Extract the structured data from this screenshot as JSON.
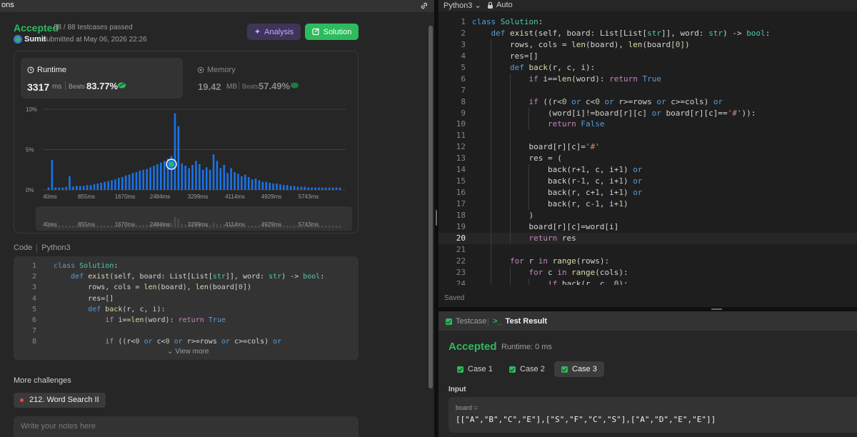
{
  "left_panel": {
    "tab_label": "ons",
    "status": "Accepted",
    "testcases": "88 / 88 testcases passed",
    "username": "Sumit",
    "submitted_text": "submitted at May 06, 2026 22:26",
    "analysis_label": "Analysis",
    "solution_label": "Solution",
    "runtime": {
      "title": "Runtime",
      "value": "3317",
      "unit": "ms",
      "beats_label": "Beats",
      "beats_value": "83.77%"
    },
    "memory": {
      "title": "Memory",
      "value": "19.42",
      "unit": "MB",
      "beats_label": "Beats",
      "beats_value": "57.49%"
    },
    "code_label": "Code",
    "code_lang": "Python3",
    "code_preview": [
      {
        "n": "1",
        "html": "<span class='kw'>class</span> <span class='ty'>Solution</span>:"
      },
      {
        "n": "2",
        "html": "    <span class='kw'>def</span> <span class='fn'>exist</span>(self, board: List[List[<span class='ty'>str</span>]], word: <span class='ty'>str</span>) -> <span class='ty'>bool</span>:"
      },
      {
        "n": "3",
        "html": "        rows, cols = <span class='fn'>len</span>(board), <span class='fn'>len</span>(board[<span class='num'>0</span>])"
      },
      {
        "n": "4",
        "html": "        res=[]"
      },
      {
        "n": "5",
        "html": "        <span class='kw'>def</span> <span class='fn'>back</span>(r, c, i):"
      },
      {
        "n": "6",
        "html": "            <span class='kw2'>if</span> i==<span class='fn'>len</span>(word): <span class='kw2'>return</span> <span class='kw'>True</span>"
      },
      {
        "n": "7",
        "html": ""
      },
      {
        "n": "8",
        "html": "            <span class='kw2'>if</span> ((r<<span class='num'>0</span> <span class='kw'>or</span> c<<span class='num'>0</span> <span class='kw'>or</span> r>=rows <span class='kw'>or</span> c>=cols) <span class='kw'>or</span>"
      }
    ],
    "view_more": "View more",
    "more_challenges": "More challenges",
    "challenge": "212. Word Search II",
    "notes_placeholder": "Write your notes here"
  },
  "chart_data": {
    "type": "bar",
    "ylabel": "",
    "ylim": [
      0,
      10
    ],
    "yticks": [
      "10%",
      "5%",
      "0%"
    ],
    "x_ticks": [
      "40ms",
      "855ms",
      "1670ms",
      "2484ms",
      "3299ms",
      "4114ms",
      "4929ms",
      "5743ms"
    ],
    "highlight_index": 36,
    "values": [
      0.3,
      3.7,
      0.3,
      0.3,
      0.3,
      0.4,
      1.7,
      0.4,
      0.5,
      0.5,
      0.5,
      0.6,
      0.6,
      0.7,
      0.8,
      0.9,
      1.0,
      1.1,
      1.2,
      1.3,
      1.5,
      1.6,
      1.8,
      1.9,
      2.1,
      2.2,
      2.4,
      2.5,
      2.6,
      2.8,
      3.0,
      3.2,
      3.4,
      3.6,
      3.9,
      4.2,
      9.5,
      7.9,
      3.3,
      3.0,
      2.7,
      3.1,
      3.6,
      3.2,
      2.5,
      2.8,
      2.5,
      4.4,
      3.6,
      2.7,
      3.1,
      2.1,
      2.7,
      2.2,
      2.0,
      1.7,
      1.9,
      1.6,
      1.3,
      1.4,
      1.2,
      1.0,
      1.0,
      0.9,
      0.8,
      0.8,
      0.7,
      0.6,
      0.6,
      0.5,
      0.5,
      0.4,
      0.4,
      0.4,
      0.3,
      0.3,
      0.3,
      0.3,
      0.3,
      0.3,
      0.3,
      0.3,
      0.3,
      0.3
    ],
    "bar_color": "#1a73e8",
    "grid": true
  },
  "editor": {
    "language": "Python3",
    "auto_label": "Auto",
    "saved_label": "Saved",
    "active_line": 20,
    "lines": [
      {
        "n": "1",
        "indent": 0,
        "html": "<span class='kw'>class</span> <span class='ty'>Solution</span>:"
      },
      {
        "n": "2",
        "indent": 1,
        "html": "    <span class='kw'>def</span> <span class='fn'>exist</span>(self, board: List[List[<span class='ty'>str</span>]], word: <span class='ty'>str</span>) -> <span class='ty'>bool</span>:"
      },
      {
        "n": "3",
        "indent": 2,
        "html": "        rows, cols = <span class='fn'>len</span>(board), <span class='fn'>len</span>(board[<span class='num'>0</span>])"
      },
      {
        "n": "4",
        "indent": 2,
        "html": "        res=[]"
      },
      {
        "n": "5",
        "indent": 2,
        "html": "        <span class='kw'>def</span> <span class='fn'>back</span>(r, c, i):"
      },
      {
        "n": "6",
        "indent": 3,
        "html": "            <span class='kw2'>if</span> i==<span class='fn'>len</span>(word): <span class='kw2'>return</span> <span class='kw'>True</span>"
      },
      {
        "n": "7",
        "indent": 3,
        "html": ""
      },
      {
        "n": "8",
        "indent": 3,
        "html": "            <span class='kw2'>if</span> ((r<<span class='num'>0</span> <span class='kw'>or</span> c<<span class='num'>0</span> <span class='kw'>or</span> r>=rows <span class='kw'>or</span> c>=cols) <span class='kw'>or</span>"
      },
      {
        "n": "9",
        "indent": 4,
        "html": "                (word[i]!=board[r][c] <span class='kw'>or</span> board[r][c]==<span class='str'>'#'</span>)):"
      },
      {
        "n": "10",
        "indent": 4,
        "html": "                <span class='kw2'>return</span> <span class='kw'>False</span>"
      },
      {
        "n": "11",
        "indent": 3,
        "html": ""
      },
      {
        "n": "12",
        "indent": 3,
        "html": "            board[r][c]=<span class='str'>'#'</span>"
      },
      {
        "n": "13",
        "indent": 3,
        "html": "            res = ("
      },
      {
        "n": "14",
        "indent": 4,
        "html": "                back(r+<span class='num'>1</span>, c, i+<span class='num'>1</span>) <span class='kw'>or</span>"
      },
      {
        "n": "15",
        "indent": 4,
        "html": "                back(r-<span class='num'>1</span>, c, i+<span class='num'>1</span>) <span class='kw'>or</span>"
      },
      {
        "n": "16",
        "indent": 4,
        "html": "                back(r, c+<span class='num'>1</span>, i+<span class='num'>1</span>) <span class='kw'>or</span>"
      },
      {
        "n": "17",
        "indent": 4,
        "html": "                back(r, c-<span class='num'>1</span>, i+<span class='num'>1</span>)"
      },
      {
        "n": "18",
        "indent": 3,
        "html": "            )"
      },
      {
        "n": "19",
        "indent": 3,
        "html": "            board[r][c]=word[i]"
      },
      {
        "n": "20",
        "indent": 3,
        "html": "            <span class='kw2'>return</span> res"
      },
      {
        "n": "21",
        "indent": 2,
        "html": ""
      },
      {
        "n": "22",
        "indent": 2,
        "html": "        <span class='kw2'>for</span> r <span class='kw2'>in</span> <span class='fn'>range</span>(rows):"
      },
      {
        "n": "23",
        "indent": 3,
        "html": "            <span class='kw2'>for</span> c <span class='kw2'>in</span> <span class='fn'>range</span>(cols):"
      },
      {
        "n": "24",
        "indent": 4,
        "html": "                <span class='kw2'>if</span> back(r, c, <span class='num'>0</span>):"
      }
    ]
  },
  "test_panel": {
    "tab_testcase": "Testcase",
    "tab_result": "Test Result",
    "status": "Accepted",
    "runtime": "Runtime: 0 ms",
    "cases": [
      "Case 1",
      "Case 2",
      "Case 3"
    ],
    "active_case": 2,
    "input_label": "Input",
    "input_var": "board =",
    "input_value": "[[\"A\",\"B\",\"C\",\"E\"],[\"S\",\"F\",\"C\",\"S\"],[\"A\",\"D\",\"E\",\"E\"]]"
  },
  "colors": {
    "accent_green": "#2cbb5d",
    "bar_blue": "#1a73e8",
    "analysis_purple": "#c8a8ff"
  }
}
